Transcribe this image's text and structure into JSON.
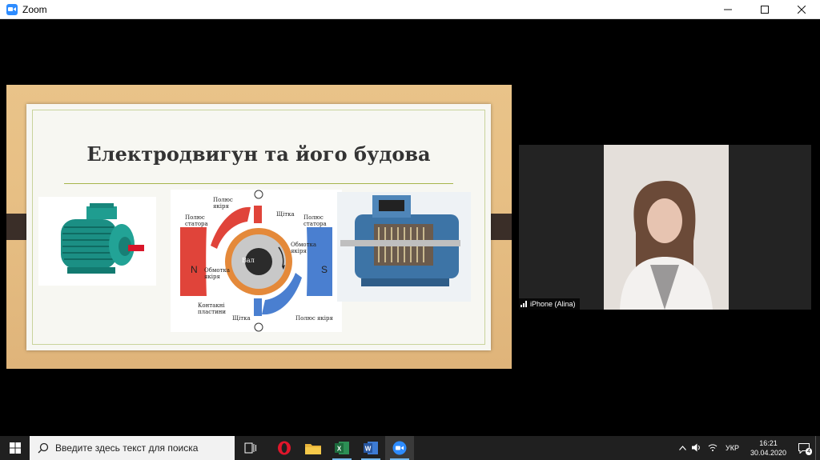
{
  "window": {
    "title": "Zoom",
    "controls": [
      "minimize",
      "maximize",
      "close"
    ]
  },
  "slide": {
    "title": "Електродвигун та його будова",
    "diagram_labels": {
      "pole_anchor_top": "Полюс якіря",
      "pole_stator_left": "Полюс статора",
      "brush_top": "Щітка",
      "pole_stator_right": "Полюс статора",
      "winding_right": "Обмотка якіря",
      "winding_left": "Обмотка якіря",
      "shaft": "Вал",
      "contact_plates": "Контакні пластини",
      "brush_bottom": "Щітка",
      "pole_anchor_bottom": "Полюс якіря",
      "north": "N",
      "south": "S",
      "plus": "+",
      "minus": "−"
    }
  },
  "participant": {
    "name": "iPhone (Alina)"
  },
  "taskbar": {
    "search_placeholder": "Введите здесь текст для поиска",
    "language": "УКР",
    "time": "16:21",
    "date": "30.04.2020",
    "notifications": "4",
    "icons": [
      "windows-start-icon",
      "task-view-icon",
      "opera-icon",
      "file-explorer-icon",
      "excel-icon",
      "word-icon",
      "zoom-icon"
    ]
  },
  "colors": {
    "zoom_blue": "#2d8cff",
    "taskbar": "#202020",
    "slide_bg": "#e7bf84",
    "pole_red": "#e0443a",
    "pole_blue": "#4a7fd0"
  }
}
